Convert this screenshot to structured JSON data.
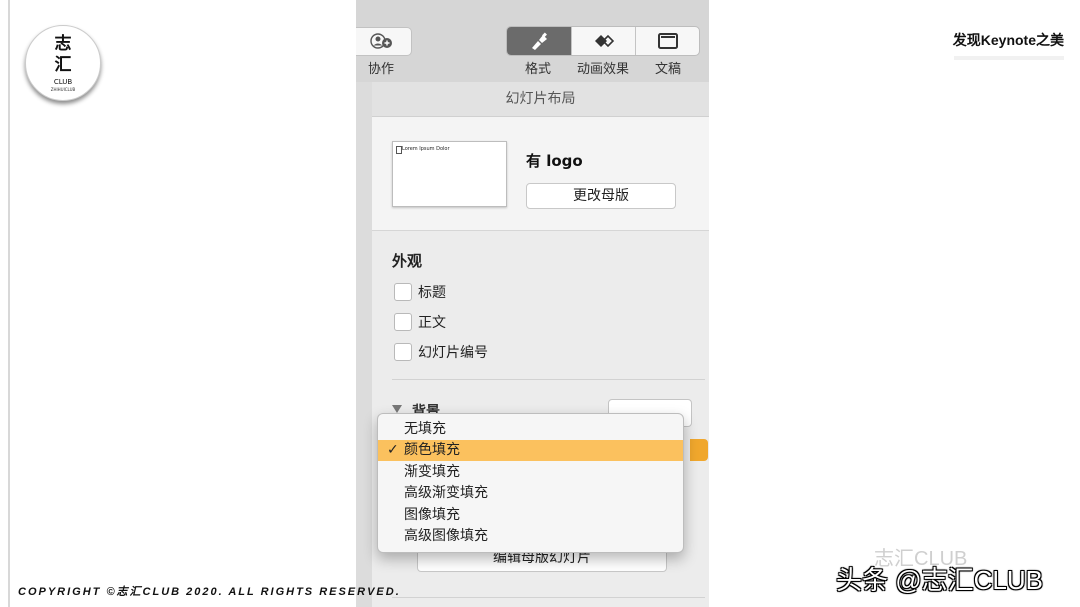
{
  "logo": {
    "line1": "志",
    "line2": "汇",
    "line3": "CLUB",
    "line4": "ZHIHUICLUB"
  },
  "header_title": "发现Keynote之美",
  "copyright": "COPYRIGHT ©志汇CLUB 2020. ALL RIGHTS RESERVED.",
  "watermark": {
    "main": "头条 @志汇CLUB",
    "faded": "志汇CLUB"
  },
  "toolbar": {
    "collaborate_label": "协作",
    "tabs": [
      {
        "label": "格式",
        "icon": "paintbrush-icon",
        "active": true
      },
      {
        "label": "动画效果",
        "icon": "diamonds-icon",
        "active": false
      },
      {
        "label": "文稿",
        "icon": "document-icon",
        "active": false
      }
    ]
  },
  "section_header": "幻灯片布局",
  "master": {
    "thumb_title": "Lorem Ipsum Dolor",
    "name": "有 logo",
    "change_button": "更改母版"
  },
  "appearance": {
    "title": "外观",
    "checkboxes": [
      {
        "label": "标题",
        "checked": false
      },
      {
        "label": "正文",
        "checked": false
      },
      {
        "label": "幻灯片编号",
        "checked": false
      }
    ]
  },
  "background": {
    "title": "背景"
  },
  "fill_menu": {
    "options": [
      "无填充",
      "颜色填充",
      "渐变填充",
      "高级渐变填充",
      "图像填充",
      "高级图像填充"
    ],
    "selected": "颜色填充",
    "check_glyph": "✓"
  },
  "edit_master_button": "编辑母版幻灯片",
  "colors": {
    "accent": "#fbc15e",
    "popup_edge": "#f0a72d",
    "active_tab": "#6b6b6b"
  }
}
